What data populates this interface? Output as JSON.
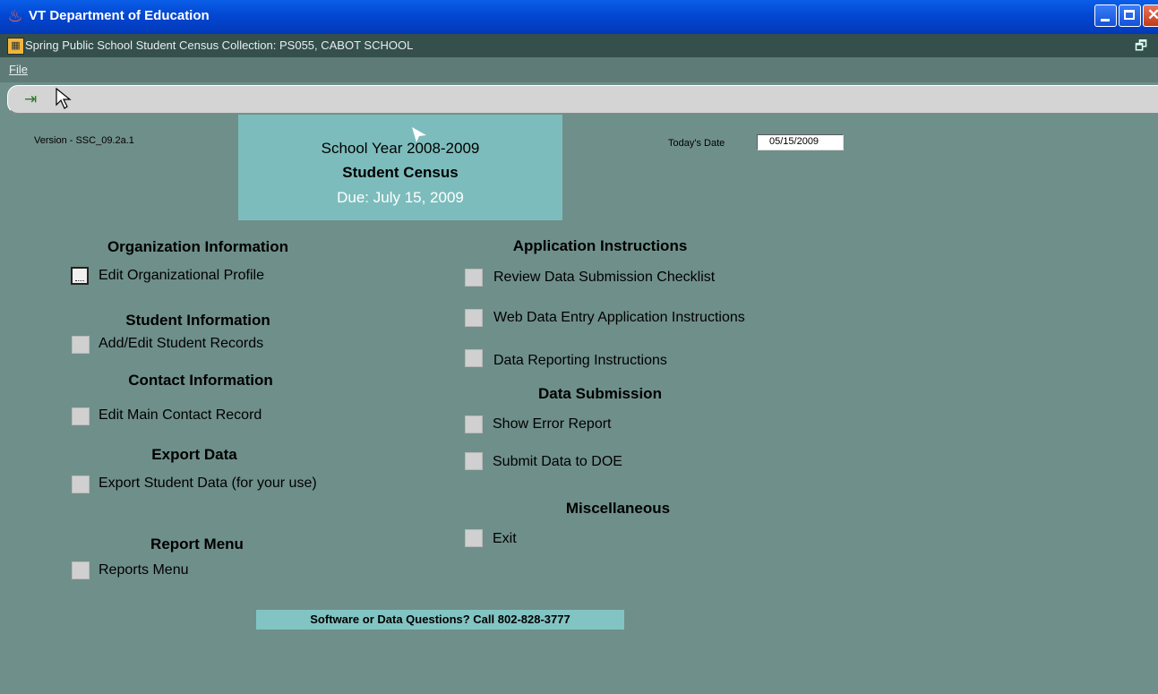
{
  "window": {
    "title": "VT Department of Education",
    "icon": "oracle-app-icon"
  },
  "form": {
    "title": "Spring Public School Student Census Collection: PS055, CABOT SCHOOL"
  },
  "menu": {
    "file": "File"
  },
  "toolbar": {
    "exit_icon": "exit-door-icon"
  },
  "header": {
    "version": "Version - SSC_09.2a.1",
    "school_year": "School Year 2008-2009",
    "census": "Student Census",
    "due": "Due:  July 15, 2009",
    "today_label": "Today's Date",
    "today_value": "05/15/2009"
  },
  "left": {
    "org_heading": "Organization Information",
    "org_item": "Edit Organizational Profile",
    "student_heading": "Student Information",
    "student_item": "Add/Edit Student Records",
    "contact_heading": "Contact Information",
    "contact_item": "Edit Main Contact Record",
    "export_heading": "Export Data",
    "export_item": "Export Student Data (for your use)",
    "report_heading": "Report Menu",
    "report_item": "Reports Menu"
  },
  "right": {
    "app_heading": "Application Instructions",
    "checklist": "Review Data Submission Checklist",
    "web_instructions": "Web Data Entry Application Instructions",
    "reporting_instructions": "Data Reporting Instructions",
    "submission_heading": "Data Submission",
    "error_report": "Show Error Report",
    "submit": "Submit Data to DOE",
    "misc_heading": "Miscellaneous",
    "exit": "Exit"
  },
  "footer": {
    "help": "Software or Data Questions?  Call 802-828-3777"
  },
  "colors": {
    "background": "#6f8f8a",
    "hero": "#7dbcbc",
    "footer": "#82c4c4",
    "titlebar": "#0347d2"
  }
}
